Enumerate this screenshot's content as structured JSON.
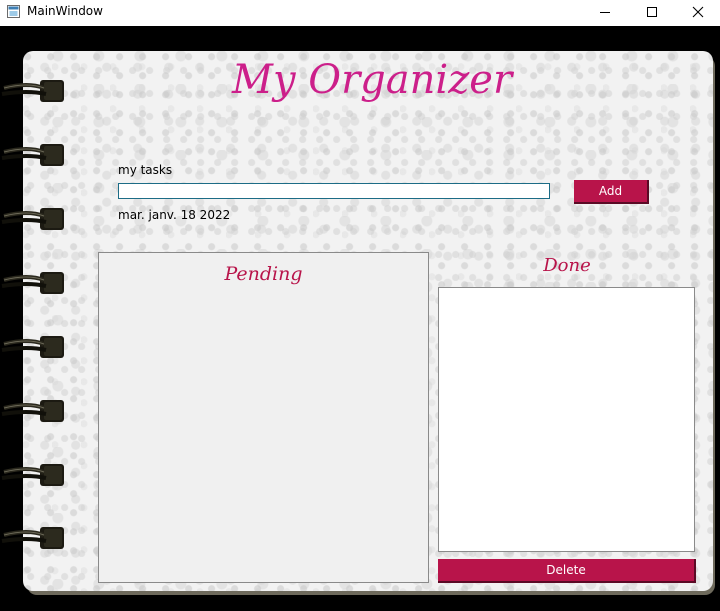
{
  "window": {
    "title": "MainWindow",
    "controls": {
      "minimize": "minimize-icon",
      "maximize": "maximize-icon",
      "close": "close-icon"
    }
  },
  "header": {
    "title": "My Organizer"
  },
  "task_entry": {
    "label": "my tasks",
    "value": "",
    "placeholder": "",
    "add_label": "Add"
  },
  "date_text": "mar. janv. 18 2022",
  "pending": {
    "title": "Pending",
    "items": []
  },
  "done": {
    "title": "Done",
    "items": [],
    "delete_label": "Delete"
  },
  "colors": {
    "accent_pink": "#cc1f8a",
    "button_crimson": "#b8144a",
    "input_border": "#1c6c86"
  }
}
